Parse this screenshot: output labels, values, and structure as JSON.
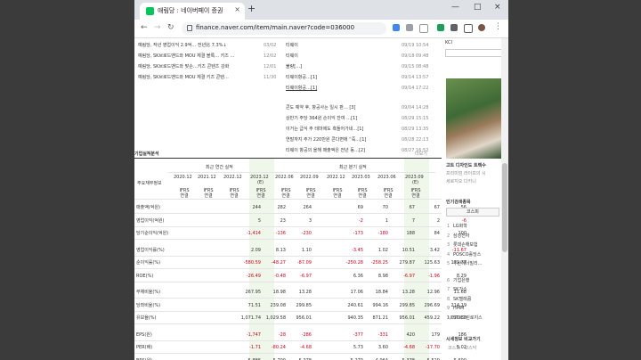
{
  "tab": {
    "title": "애림당 : 네이버페이 증권",
    "close": "×",
    "new": "+"
  },
  "window": {
    "min": "—",
    "max": "□",
    "close": "×"
  },
  "address": {
    "url": "finance.naver.com/item/main.naver?code=036000"
  },
  "news_top": [
    {
      "title": "예림당, 작년 영업이익 2.9억… 전년比 7.3%↓",
      "date": "03/02"
    },
    {
      "title": "예림당, SK브로드밴드와 MOU 체결 블록… 키즈 …",
      "date": "12/02"
    },
    {
      "title": "예림당, SK브로드밴드와 맞손…키즈 콘텐츠 강화",
      "date": "12/01"
    },
    {
      "title": "예림당, SK브로드밴드와 MOU 체결 키즈 콘텐…",
      "date": "11/30"
    }
  ],
  "disclosures": [
    {
      "title": "티웨이",
      "date": "09/19 10:54"
    },
    {
      "title": "티웨이",
      "date": "09/18 09:48"
    },
    {
      "title": "불량[…]",
      "date": "09/15 08:48"
    },
    {
      "title": "티웨이항공…[1]",
      "date": "09/14 13:57"
    },
    {
      "title": "티웨이항공…[1]",
      "date": "09/14 17:22"
    }
  ],
  "board": [
    {
      "title": "콘도 예약 후, 항공사는 일시 판… [3]",
      "date": "09/04 14:28"
    },
    {
      "title": "상반기 주당 364원 손이익 잔여 …[1]",
      "date": "08/29 15:15"
    },
    {
      "title": "이거는 급식 주 테마에도 흑돌어가네…[1]",
      "date": "08/29 13:35"
    },
    {
      "title": "연말까지 주가 220만원 콘다변에 “죽…[1]",
      "date": "08/28 22:13"
    },
    {
      "title": "티웨이 항공의 올해 매출액은 전년 동…[2]",
      "date": "08/27 16:52"
    }
  ],
  "section_title": "기업실적분석",
  "more": "더보기",
  "header": {
    "label": "주요재무정보",
    "annual": "최근 연간 실적",
    "quarter": "최근 분기 실적",
    "years": [
      "2020.12",
      "2021.12",
      "2022.12",
      "2023.12",
      "2022.06",
      "2022.09",
      "2022.12",
      "2023.03",
      "2023.06",
      "2023.09"
    ],
    "est": "(E)",
    "basis": "IFRS 연결"
  },
  "rows": [
    {
      "label": "매출액(억원)",
      "values": [
        "244",
        "282",
        "264",
        "",
        "69",
        "70",
        "67",
        "67",
        "56",
        ""
      ]
    },
    {
      "label": "영업이익(억원)",
      "values": [
        "5",
        "23",
        "3",
        "",
        "-2",
        "1",
        "7",
        "2",
        "-6",
        ""
      ]
    },
    {
      "label": "당기순이익(억원)",
      "values": [
        "-1,414",
        "-136",
        "-230",
        "",
        "-173",
        "-180",
        "188",
        "84",
        "100",
        ""
      ]
    },
    {
      "label": "영업이익률(%)",
      "values": [
        "2.09",
        "8.13",
        "1.10",
        "",
        "-3.45",
        "1.02",
        "10.51",
        "3.42",
        "-11.67",
        ""
      ]
    },
    {
      "label": "순이익률(%)",
      "values": [
        "-580.59",
        "-48.27",
        "-87.09",
        "",
        "-250.28",
        "-258.25",
        "279.87",
        "125.63",
        "179.77",
        ""
      ]
    },
    {
      "label": "ROE(%)",
      "values": [
        "-26.49",
        "-0.48",
        "-6.97",
        "",
        "6.36",
        "8.98",
        "-6.97",
        "-1.96",
        "8.29",
        ""
      ]
    },
    {
      "label": "부채비율(%)",
      "values": [
        "267.95",
        "18.98",
        "13.28",
        "",
        "17.06",
        "18.84",
        "13.28",
        "12.96",
        "11.68",
        ""
      ]
    },
    {
      "label": "당좌비율(%)",
      "values": [
        "71.51",
        "239.08",
        "299.85",
        "",
        "240.61",
        "994.16",
        "299.85",
        "296.69",
        "214.19",
        ""
      ]
    },
    {
      "label": "유보율(%)",
      "values": [
        "1,071.74",
        "1,029.58",
        "956.01",
        "",
        "940.35",
        "871.21",
        "956.01",
        "459.22",
        "1,030.80",
        ""
      ]
    },
    {
      "label": "EPS(원)",
      "values": [
        "-1,747",
        "-28",
        "-286",
        "",
        "-377",
        "-331",
        "420",
        "179",
        "186",
        ""
      ]
    },
    {
      "label": "PER(배)",
      "values": [
        "-1.71",
        "-80.24",
        "-4.68",
        "",
        "5.73",
        "3.60",
        "-4.68",
        "-17.70",
        "5.02",
        ""
      ]
    },
    {
      "label": "BPS(원)",
      "values": [
        "5,886",
        "5,709",
        "5,378",
        "",
        "5,279",
        "4,964",
        "5,378",
        "5,519",
        "5,690",
        ""
      ]
    }
  ],
  "sidebar": {
    "kci": "KCI",
    "ad_title": "고트 디자인도 트렉수",
    "ad_line2": "프리미엄 라이프의 시",
    "ad_line3": "세로지오 다카니",
    "popular": "인기검색종목",
    "kospi": "코스피",
    "stocks": [
      "LG화학",
      "삼성전자",
      "롯데손해보험",
      "POSCO홀딩스",
      "두산에너빌리…",
      "기업은행",
      "SK가스",
      "SK텔레콤",
      "HMM",
      "STX그린로지스"
    ],
    "compare": "시세정보 비교가기",
    "compare_tabs": "코스피  ·  코스닥"
  }
}
